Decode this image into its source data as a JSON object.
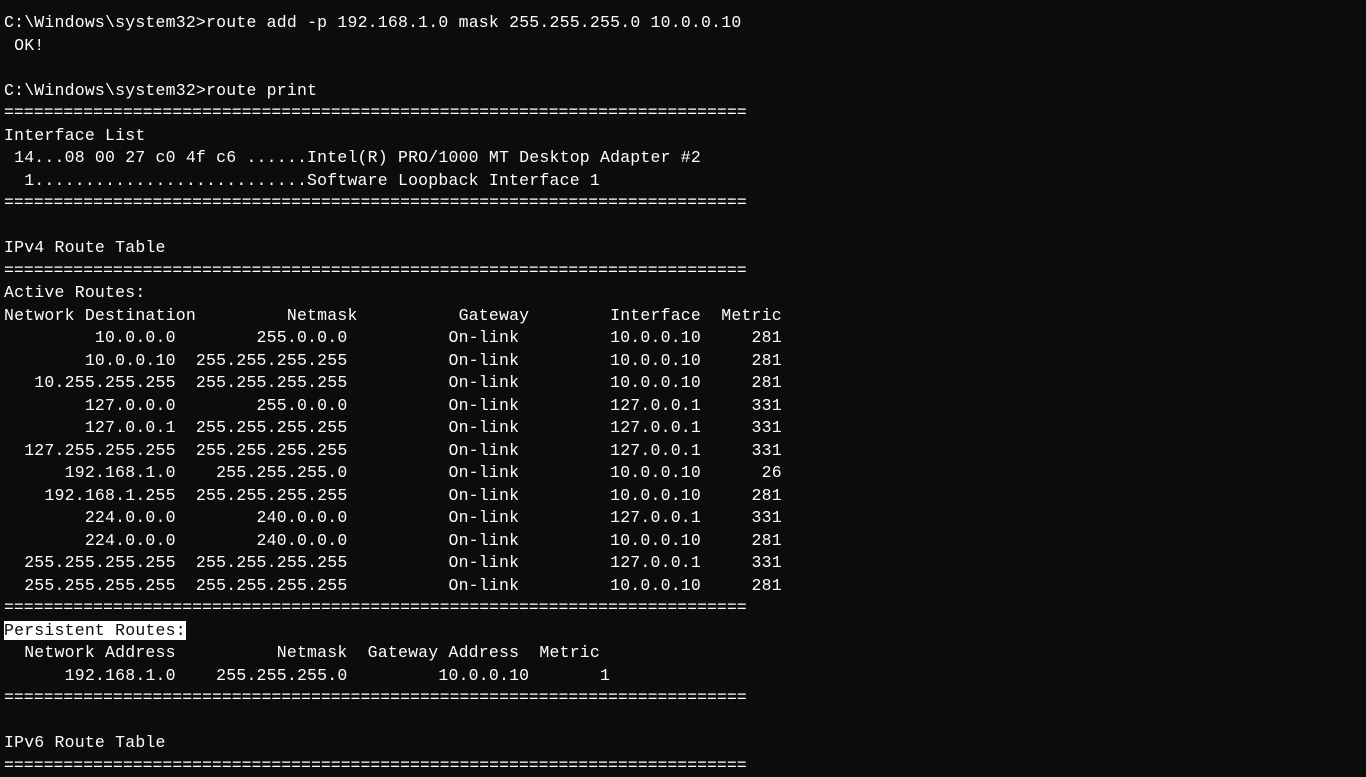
{
  "prompt": "C:\\Windows\\system32>",
  "cmd1": "route add -p 192.168.1.0 mask 255.255.255.0 10.0.0.10",
  "ok": " OK!",
  "cmd2": "route print",
  "hr": "===========================================================================",
  "iface_list_header": "Interface List",
  "iface_lines": [
    " 14...08 00 27 c0 4f c6 ......Intel(R) PRO/1000 MT Desktop Adapter #2",
    "  1...........................Software Loopback Interface 1"
  ],
  "ipv4_header": "IPv4 Route Table",
  "active_routes_header": "Active Routes:",
  "active_cols": [
    "Network Destination",
    "Netmask",
    "Gateway",
    "Interface",
    "Metric"
  ],
  "active_routes": [
    {
      "dest": "10.0.0.0",
      "mask": "255.0.0.0",
      "gw": "On-link",
      "iface": "10.0.0.10",
      "metric": "281"
    },
    {
      "dest": "10.0.0.10",
      "mask": "255.255.255.255",
      "gw": "On-link",
      "iface": "10.0.0.10",
      "metric": "281"
    },
    {
      "dest": "10.255.255.255",
      "mask": "255.255.255.255",
      "gw": "On-link",
      "iface": "10.0.0.10",
      "metric": "281"
    },
    {
      "dest": "127.0.0.0",
      "mask": "255.0.0.0",
      "gw": "On-link",
      "iface": "127.0.0.1",
      "metric": "331"
    },
    {
      "dest": "127.0.0.1",
      "mask": "255.255.255.255",
      "gw": "On-link",
      "iface": "127.0.0.1",
      "metric": "331"
    },
    {
      "dest": "127.255.255.255",
      "mask": "255.255.255.255",
      "gw": "On-link",
      "iface": "127.0.0.1",
      "metric": "331"
    },
    {
      "dest": "192.168.1.0",
      "mask": "255.255.255.0",
      "gw": "On-link",
      "iface": "10.0.0.10",
      "metric": "26"
    },
    {
      "dest": "192.168.1.255",
      "mask": "255.255.255.255",
      "gw": "On-link",
      "iface": "10.0.0.10",
      "metric": "281"
    },
    {
      "dest": "224.0.0.0",
      "mask": "240.0.0.0",
      "gw": "On-link",
      "iface": "127.0.0.1",
      "metric": "331"
    },
    {
      "dest": "224.0.0.0",
      "mask": "240.0.0.0",
      "gw": "On-link",
      "iface": "10.0.0.10",
      "metric": "281"
    },
    {
      "dest": "255.255.255.255",
      "mask": "255.255.255.255",
      "gw": "On-link",
      "iface": "127.0.0.1",
      "metric": "331"
    },
    {
      "dest": "255.255.255.255",
      "mask": "255.255.255.255",
      "gw": "On-link",
      "iface": "10.0.0.10",
      "metric": "281"
    }
  ],
  "persistent_header": "Persistent Routes:",
  "persistent_cols": [
    "Network Address",
    "Netmask",
    "Gateway Address",
    "Metric"
  ],
  "persistent_routes": [
    {
      "addr": "192.168.1.0",
      "mask": "255.255.255.0",
      "gw": "10.0.0.10",
      "metric": "1"
    }
  ],
  "ipv6_header": "IPv6 Route Table"
}
